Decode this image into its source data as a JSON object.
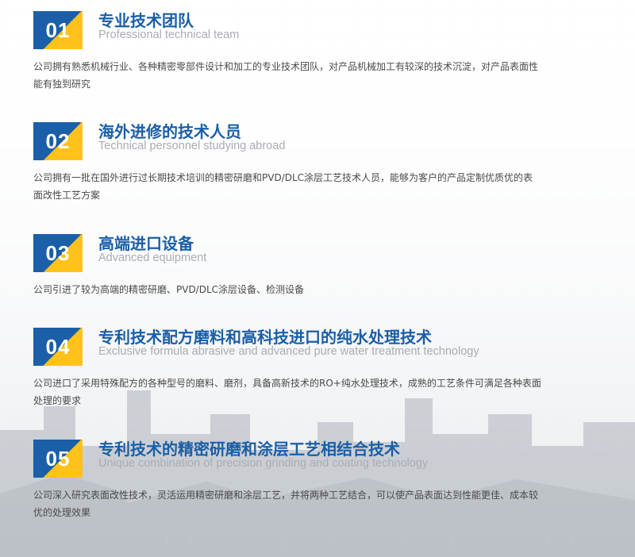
{
  "items": [
    {
      "number": "01",
      "title": "专业技术团队",
      "subtitle": "Professional technical team",
      "description": "公司拥有熟悉机械行业、各种精密零部件设计和加工的专业技术团队，对产品机械加工有较深的技术沉淀，对产品表面性能有独到研究"
    },
    {
      "number": "02",
      "title": "海外进修的技术人员",
      "subtitle": "Technical personnel studying abroad",
      "description": "公司拥有一批在国外进行过长期技术培训的精密研磨和PVD/DLC涂层工艺技术人员，能够为客户的产品定制优质优的表面改性工艺方案"
    },
    {
      "number": "03",
      "title": "高端进口设备",
      "subtitle": "Advanced equipment",
      "description": "公司引进了较为高端的精密研磨、PVD/DLC涂层设备、检测设备"
    },
    {
      "number": "04",
      "title": "专利技术配方磨料和高科技进口的纯水处理技术",
      "subtitle": "Exclusive formula abrasive and advanced pure water treatment technology",
      "description": "公司进口了采用特殊配方的各种型号的磨料、磨剂，具备高新技术的RO+纯水处理技术，成熟的工艺条件可满足各种表面处理的要求"
    },
    {
      "number": "05",
      "title": "专利技术的精密研磨和涂层工艺相结合技术",
      "subtitle": "Unique combination of precision grinding and coating technology",
      "description": "公司深入研究表面改性技术，灵活运用精密研磨和涂层工艺，并将两种工艺结合，可以使产品表面达到性能更佳、成本较优的处理效果"
    }
  ],
  "colors": {
    "brand_blue": "#1a5fa8",
    "accent_yellow": "#ffc21a",
    "subtitle_gray": "#a9acb1",
    "text_gray": "#4a4a4a"
  }
}
